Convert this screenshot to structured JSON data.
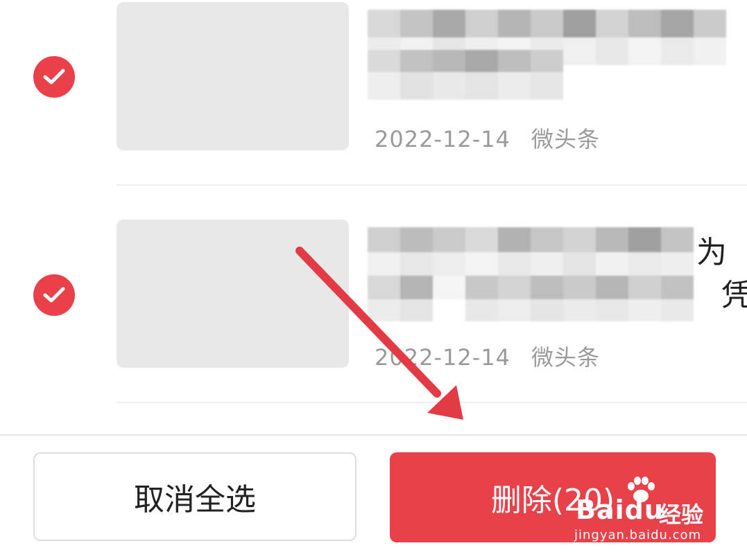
{
  "items": [
    {
      "checked": true,
      "date": "2022-12-14",
      "source": "微头条",
      "title_partial": "",
      "title_partial_2": ""
    },
    {
      "checked": true,
      "date": "2022-12-14",
      "source": "微头条",
      "title_partial": "为",
      "title_partial_2": "凭"
    }
  ],
  "bottom_bar": {
    "cancel_select_all_label": "取消全选",
    "delete_label": "删除(20)"
  },
  "watermark": {
    "brand": "Baidu",
    "brand_cn": "经验",
    "url": "jingyan.baidu.com"
  },
  "colors": {
    "accent_red": "#e9404a",
    "meta_gray": "#9a9a9a",
    "thumb_gray": "#e8e8e8"
  },
  "icons": {
    "check": "check-circle-icon",
    "annotation": "red-arrow-annotation"
  }
}
